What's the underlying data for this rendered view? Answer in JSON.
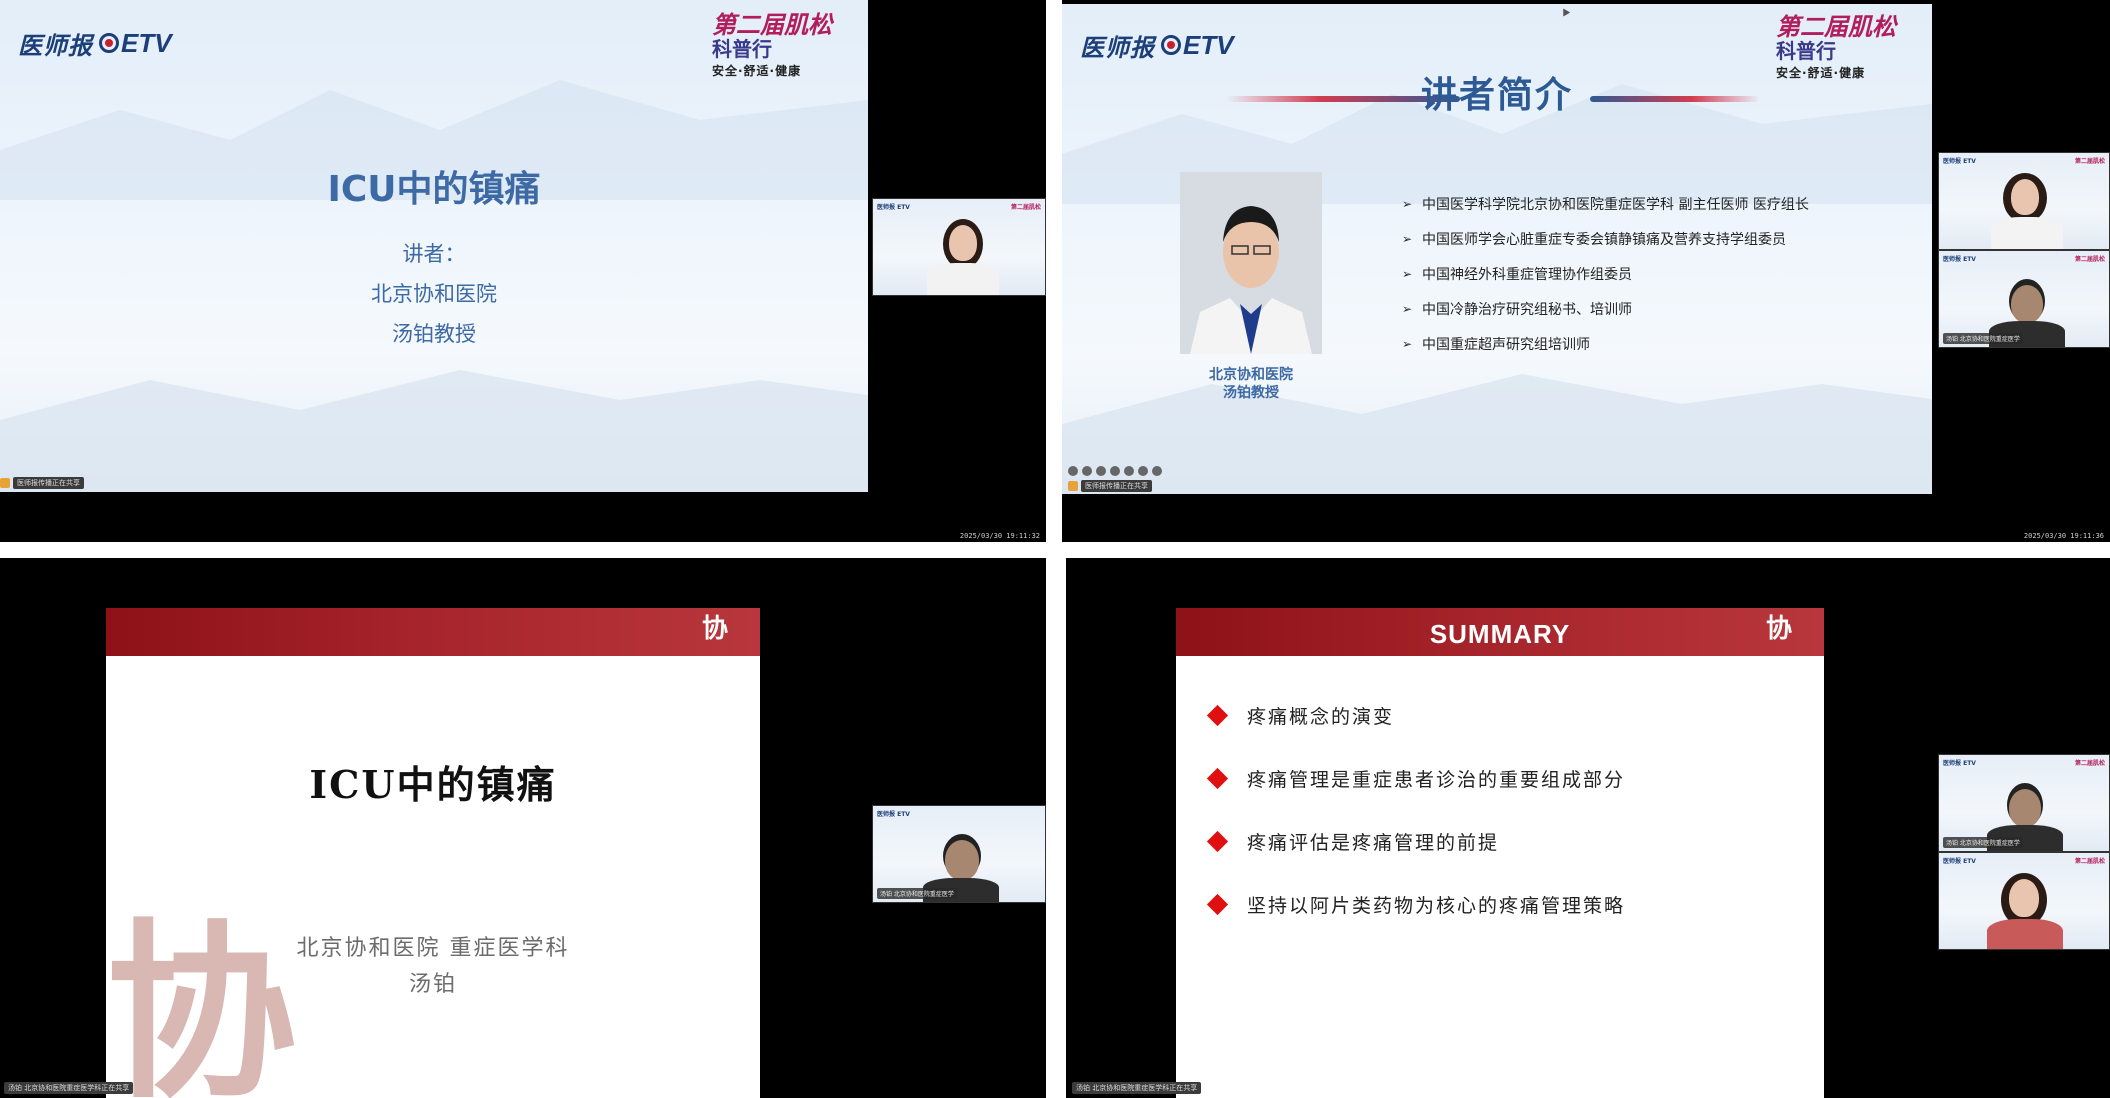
{
  "q1": {
    "brand": "医师报",
    "etv": "ETV",
    "event_line1": "第二届肌松",
    "event_line2": "科普行",
    "event_sub": "安全·舒适·健康",
    "title": "ICU中的镇痛",
    "speaker_label": "讲者：",
    "hospital": "北京协和医院",
    "speaker": "汤铂教授",
    "status": "医师报传播正在共享",
    "timestamp": "2025/03/30 19:11:32"
  },
  "q2": {
    "brand": "医师报",
    "etv": "ETV",
    "event_line1": "第二届肌松",
    "event_line2": "科普行",
    "event_sub": "安全·舒适·健康",
    "heading": "讲者简介",
    "photo_name_1": "北京协和医院",
    "photo_name_2": "汤铂教授",
    "bullets": [
      "中国医学科学院北京协和医院重症医学科 副主任医师 医疗组长",
      "中国医师学会心脏重症专委会镇静镇痛及营养支持学组委员",
      "中国神经外科重症管理协作组委员",
      "中国冷静治疗研究组秘书、培训师",
      "中国重症超声研究组培训师"
    ],
    "status": "医师报传播正在共享",
    "thumb_label": "汤铂 北京协和医院重症医学",
    "timestamp": "2025/03/30 19:11:36"
  },
  "q3": {
    "title": "ICU中的镇痛",
    "subtitle": "北京协和医院 重症医学科",
    "author": "汤铂",
    "seal": "协",
    "watermark": "协",
    "thumb_label": "汤铂 北京协和医院重症医学",
    "status": "汤铂 北京协和医院重症医学科正在共享"
  },
  "q4": {
    "title": "SUMMARY",
    "seal": "协",
    "items": [
      "疼痛概念的演变",
      "疼痛管理是重症患者诊治的重要组成部分",
      "疼痛评估是疼痛管理的前提",
      "坚持以阿片类药物为核心的疼痛管理策略"
    ],
    "thumb_label": "汤铂 北京协和医院重症医学",
    "status": "汤铂 北京协和医院重症医学科正在共享"
  }
}
